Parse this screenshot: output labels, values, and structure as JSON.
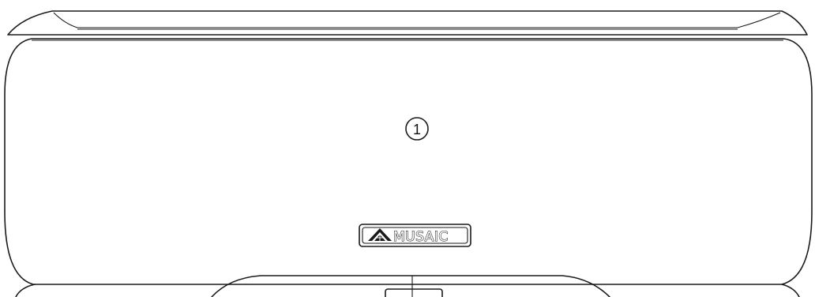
{
  "callout": {
    "number": "1"
  },
  "logo": {
    "brand": "MUSAIC"
  },
  "colors": {
    "outline": "#1a1a1a",
    "background": "#ffffff"
  }
}
